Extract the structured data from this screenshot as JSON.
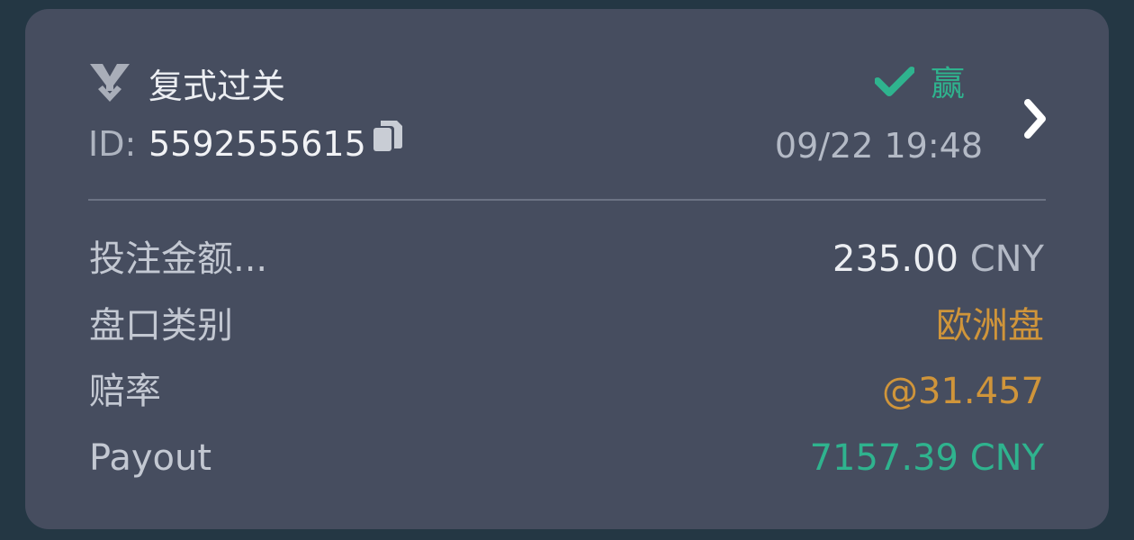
{
  "bet": {
    "type_icon": "parlay-branch-icon",
    "type_label": "复式过关",
    "id_label": "ID:",
    "id_value": "5592555615",
    "copy_icon": "copy-icon",
    "status_icon": "checkmark-icon",
    "status_label": "赢",
    "datetime": "09/22 19:48",
    "details_icon": "chevron-right-icon",
    "rows": [
      {
        "label": "投注金额...",
        "value": "235.00",
        "unit": "CNY"
      },
      {
        "label": "盘口类别",
        "value": "欧洲盘"
      },
      {
        "label": "赔率",
        "value": "@31.457"
      },
      {
        "label": "Payout",
        "value": "7157.39 CNY"
      }
    ]
  },
  "colors": {
    "background": "#243744",
    "card": "#464d5f",
    "win_green": "#2fb38e",
    "accent_gold": "#d0953a",
    "label_gray": "#c3c8d2"
  }
}
